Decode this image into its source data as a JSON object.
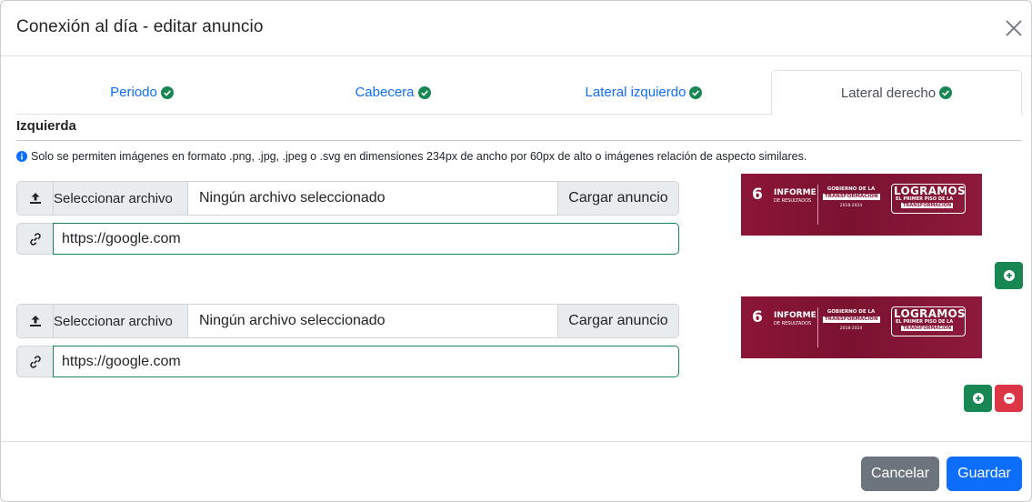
{
  "modal": {
    "title": "Conexión al día - editar anuncio"
  },
  "tabs": [
    {
      "label": "Periodo",
      "active": false,
      "completed": true
    },
    {
      "label": "Cabecera",
      "active": false,
      "completed": true
    },
    {
      "label": "Lateral izquierdo",
      "active": false,
      "completed": true
    },
    {
      "label": "Lateral derecho",
      "active": true,
      "completed": true
    }
  ],
  "section": {
    "title": "Izquierda",
    "info": "Solo se permiten imágenes en formato .png, .jpg, .jpeg o .svg en dimensiones 234px de ancho por 60px de alto o imágenes relación de aspecto similares."
  },
  "ads": [
    {
      "file_button": "Seleccionar archivo",
      "file_name": "Ningún archivo seleccionado",
      "upload_label": "Cargar anuncio",
      "url": "https://google.com",
      "banner": {
        "num": "6",
        "num_sup": "to",
        "informe": "INFORME",
        "resultados": "DE RESULTADOS",
        "gob_line1": "GOBIERNO DE LA",
        "gob_line2": "TRANSFORMACIÓN",
        "years": "2018-2024",
        "logros": "LOGRAMOS",
        "logros_sub": "EL PRIMER PISO DE LA",
        "logros_sub2": "TRANSFORMACIÓN"
      }
    },
    {
      "file_button": "Seleccionar archivo",
      "file_name": "Ningún archivo seleccionado",
      "upload_label": "Cargar anuncio",
      "url": "https://google.com",
      "banner": {
        "num": "6",
        "num_sup": "to",
        "informe": "INFORME",
        "resultados": "DE RESULTADOS",
        "gob_line1": "GOBIERNO DE LA",
        "gob_line2": "TRANSFORMACIÓN",
        "years": "2018-2024",
        "logros": "LOGRAMOS",
        "logros_sub": "EL PRIMER PISO DE LA",
        "logros_sub2": "TRANSFORMACIÓN"
      }
    }
  ],
  "footer": {
    "cancel_label": "Cancelar",
    "save_label": "Guardar"
  },
  "colors": {
    "primary": "#0d6efd",
    "success": "#198754",
    "danger": "#dc3545",
    "secondary": "#6c757d",
    "banner": "#8c1537"
  },
  "icons": {
    "close": "close-icon",
    "check": "check-circle-icon",
    "info": "info-circle-icon",
    "upload": "upload-icon",
    "link": "link-icon",
    "add": "plus-circle-icon",
    "remove": "minus-circle-icon"
  }
}
